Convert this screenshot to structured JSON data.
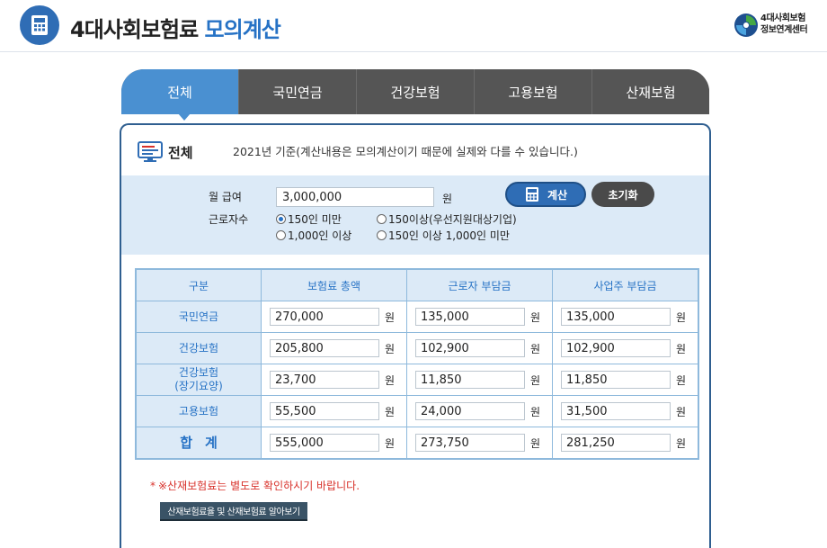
{
  "header": {
    "title_main": "4대사회보험료",
    "title_accent": "모의계산",
    "org_line1": "4대사회보험",
    "org_line2": "정보연계센터"
  },
  "tabs": [
    {
      "label": "전체",
      "active": true
    },
    {
      "label": "국민연금",
      "active": false
    },
    {
      "label": "건강보험",
      "active": false
    },
    {
      "label": "고용보험",
      "active": false
    },
    {
      "label": "산재보험",
      "active": false
    }
  ],
  "panel": {
    "title": "전체",
    "note": "2021년 기준(계산내용은 모의계산이기 때문에 실제와 다를 수 있습니다.)",
    "salary_label": "월 급여",
    "salary_value": "3,000,000",
    "won": "원",
    "calc_button": "계산",
    "reset_button": "초기화",
    "workers_label": "근로자수",
    "radio_options": [
      {
        "label": "150인 미만",
        "checked": true
      },
      {
        "label": "150이상(우선지원대상기업)",
        "checked": false
      },
      {
        "label": "1,000인 이상",
        "checked": false
      },
      {
        "label": "150인 이상 1,000인 미만",
        "checked": false
      }
    ]
  },
  "table": {
    "headers": [
      "구분",
      "보험료 총액",
      "근로자 부담금",
      "사업주 부담금"
    ],
    "rows": [
      {
        "label": "국민연금",
        "values": [
          "270,000",
          "135,000",
          "135,000"
        ]
      },
      {
        "label": "건강보험",
        "values": [
          "205,800",
          "102,900",
          "102,900"
        ]
      },
      {
        "label": "건강보험\n(장기요양)",
        "values": [
          "23,700",
          "11,850",
          "11,850"
        ]
      },
      {
        "label": "고용보험",
        "values": [
          "55,500",
          "24,000",
          "31,500"
        ]
      },
      {
        "label": "합계",
        "values": [
          "555,000",
          "273,750",
          "281,250"
        ]
      }
    ]
  },
  "footer": {
    "warning_star": "*",
    "warning": "※산재보험료는 별도로 확인하시기 바랍니다.",
    "link_button": "산재보험료율 및 산재보험료 알아보기"
  },
  "icons": {
    "header_icon": "calculator-icon",
    "panel_icon": "monitor-icon",
    "org_logo": "org-logo-icon"
  },
  "colors": {
    "accent": "#2672c5",
    "tab_active": "#4a90d1",
    "tab_inactive": "#555555",
    "table_header_bg": "#dceaf7",
    "warning": "#d8322b"
  }
}
